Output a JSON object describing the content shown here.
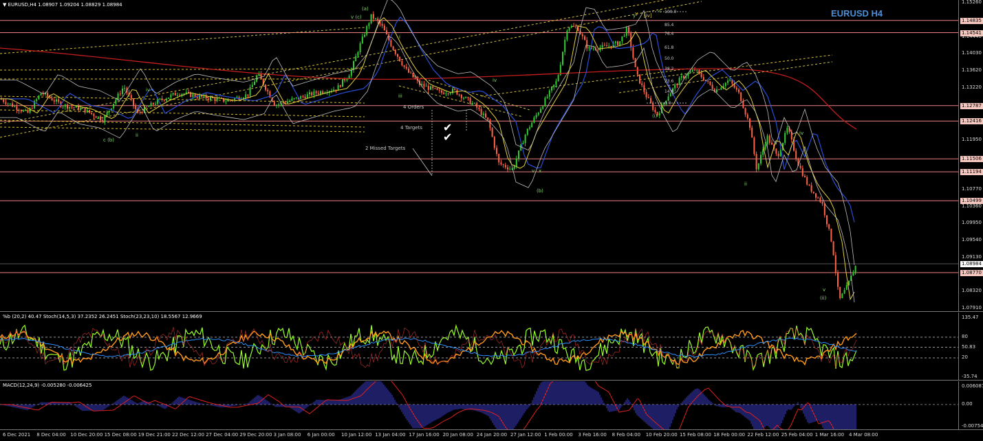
{
  "chart_header": {
    "symbol_info": "EURUSD,H4  1.08907 1.09204 1.08829 1.08984",
    "title": "EURUSD H4"
  },
  "price_axis": {
    "ticks": [
      "1.15260",
      "1.14440",
      "1.14030",
      "1.13620",
      "1.13220",
      "1.12380",
      "1.11950",
      "1.10770",
      "1.10360",
      "1.09950",
      "1.09540",
      "1.09130",
      "1.08320",
      "1.07910"
    ],
    "level_tags": [
      {
        "label": "1.14835",
        "price": 1.14835
      },
      {
        "label": "1.14541",
        "price": 1.14541
      },
      {
        "label": "1.12787",
        "price": 1.12787
      },
      {
        "label": "1.12416",
        "price": 1.12416
      },
      {
        "label": "1.11506",
        "price": 1.11506
      },
      {
        "label": "1.11194",
        "price": 1.11194
      },
      {
        "label": "1.10499",
        "price": 1.10499
      },
      {
        "label": "1.08770",
        "price": 1.0877
      }
    ],
    "current_price": {
      "label": "1.08984",
      "price": 1.08984
    }
  },
  "date_axis": [
    "6 Dec 2021",
    "8 Dec 04:00",
    "10 Dec 20:00",
    "15 Dec 08:00",
    "19 Dec 21:00",
    "22 Dec 12:00",
    "27 Dec 04:00",
    "29 Dec 20:00",
    "3 Jan 08:00",
    "6 Jan 00:00",
    "10 Jan 12:00",
    "13 Jan 04:00",
    "17 Jan 16:00",
    "20 Jan 08:00",
    "24 Jan 20:00",
    "27 Jan 12:00",
    "1 Feb 00:00",
    "3 Feb 16:00",
    "8 Feb 04:00",
    "10 Feb 20:00",
    "15 Feb 08:00",
    "18 Feb 00:00",
    "22 Feb 12:00",
    "25 Feb 04:00",
    "1 Mar 16:00",
    "4 Mar 08:00"
  ],
  "annotations": {
    "orders": "4 Orders",
    "targets": "4 Targets",
    "missed": "2 Missed Targets"
  },
  "wave_labels": [
    "(a)",
    "v (c)",
    "iv",
    "iii",
    "c (b)",
    "ii",
    "i",
    "(b)",
    "v",
    "x",
    "y",
    "iv",
    "(i)",
    "(ii)",
    "ii",
    "v",
    "iv",
    "c",
    "Y",
    "[iv]"
  ],
  "fib_levels": [
    "100.0",
    "85.4",
    "76.4",
    "61.8",
    "50.0",
    "38.2",
    "23.6",
    "14.6",
    "0.0"
  ],
  "stoch_pane": {
    "header": "%b (20,2) 40.47  Stoch(14,5,3) 37.2352 26.2451  Stoch(23,23,10) 18.5567 12.9669",
    "ticks": [
      "135.47",
      "80",
      "50.83",
      "20",
      "-35.74"
    ]
  },
  "macd_pane": {
    "header": "MACD(12,24,9) -0.005280 -0.006425",
    "ticks": [
      "0.006087",
      "0.00",
      "-0.007543"
    ]
  },
  "colors": {
    "background": "#000000",
    "bull": "#32cd32",
    "bear": "#ff6347",
    "level_line": "#f08080",
    "ma_red": "#c81e1e",
    "ma_blue": "#2a4fd8",
    "ma_yellow": "#e6d23c",
    "bands": "#c0c0c0",
    "title": "#4a8fd8"
  }
}
